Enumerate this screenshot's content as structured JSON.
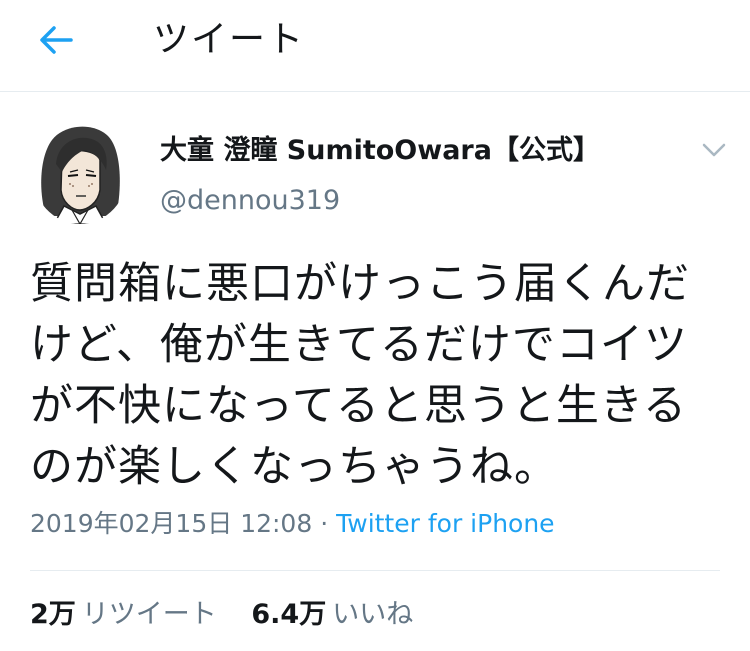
{
  "header": {
    "title": "ツイート",
    "back_icon": "arrow-left-icon",
    "accent": "#1da1f2"
  },
  "user": {
    "display_name": "大童 澄瞳 SumitoOwara【公式】",
    "handle": "@dennou319",
    "avatar_icon": "user-avatar"
  },
  "tweet": {
    "lines": [
      "質問箱に悪口がけっこう届くんだ",
      "けど、俺が生きてるだけでコイツ",
      "が不快になってると思うと生きる",
      "のが楽しくなっちゃうね。"
    ],
    "timestamp": "2019年02月15日 12:08",
    "separator": "·",
    "source": "Twitter for iPhone"
  },
  "stats": {
    "retweets": {
      "count": "2万",
      "label": "リツイート"
    },
    "likes": {
      "count": "6.4万",
      "label": "いいね"
    }
  },
  "colors": {
    "text": "#14171a",
    "secondary": "#657786",
    "link": "#1da1f2",
    "border": "#e6ecf0"
  }
}
